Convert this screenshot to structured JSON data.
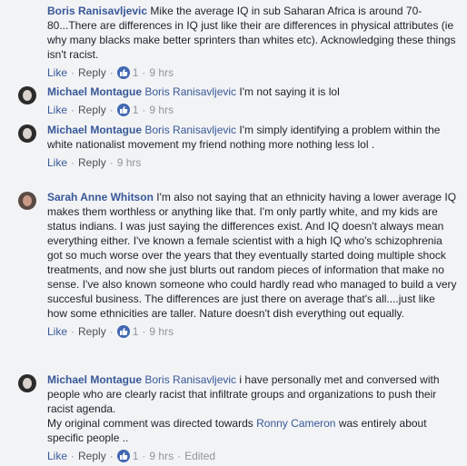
{
  "labels": {
    "like": "Like",
    "reply": "Reply",
    "dot": "·",
    "edited": "Edited"
  },
  "comments": [
    {
      "author": "Boris Ranisavljevic",
      "mention": "",
      "text": "Mike the average IQ in sub Saharan Africa is around 70-80...There are differences in IQ just like their are differences in physical attributes (ie why many blacks make better sprinters than whites etc). Acknowledging these things isn't racist.",
      "likes": "1",
      "time": "9 hrs"
    },
    {
      "author": "Michael Montague",
      "mention": "Boris Ranisavljevic",
      "text": "I'm not saying it is lol",
      "likes": "1",
      "time": "9 hrs"
    },
    {
      "author": "Michael Montague",
      "mention": "Boris Ranisavljevic",
      "text": "I'm simply identifying a problem within the white nationalist movement my friend nothing more nothing less lol .",
      "likes": "",
      "time": "9 hrs"
    },
    {
      "author": "Sarah Anne Whitson",
      "mention": "",
      "text": "I'm also not saying that an ethnicity having a lower average IQ makes them worthless or anything like that. I'm only partly white, and my kids are status indians. I was just saying the differences exist. And IQ doesn't always mean everything either. I've known a female scientist with a high IQ who's schizophrenia got so much worse over the years that they eventually started doing multiple shock treatments, and now she just blurts out random pieces of information that make no sense. I've also known someone who could hardly read who managed to build a very succesful business. The differences are just there on average that's all....just like how some ethnicities are taller. Nature doesn't dish everything out equally.",
      "likes": "1",
      "time": "9 hrs"
    },
    {
      "author": "Michael Montague",
      "mention": "Boris Ranisavljevic",
      "text": "i have personally met and conversed with people who are clearly racist that infiltrate groups and organizations to push their racist agenda.",
      "text2_pre": "My original comment was directed towards",
      "text2_link": "Ronny Cameron",
      "text2_post": "was entirely about specific people ..",
      "likes": "1",
      "time": "9 hrs"
    }
  ]
}
